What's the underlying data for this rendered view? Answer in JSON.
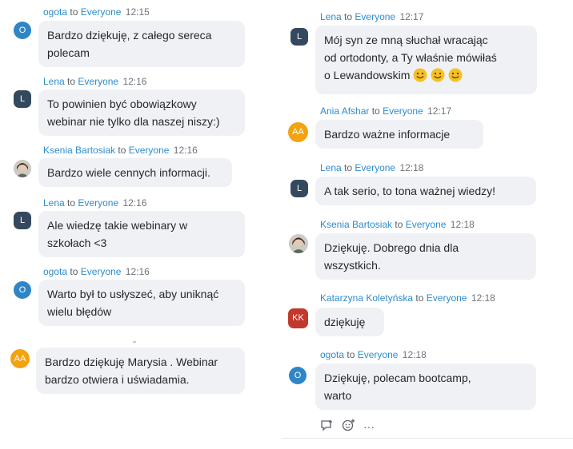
{
  "colors": {
    "name_blue": "#2d8ccf",
    "avatar_O": "#2f86c6",
    "avatar_L": "#34495e",
    "avatar_AA": "#f2a30f",
    "avatar_KK": "#c0392b",
    "bubble_bg": "#eff1f4"
  },
  "left": {
    "messages": [
      {
        "sender": "ogota",
        "to": "to",
        "target": "Everyone",
        "time": "12:15",
        "avatar": "O",
        "lines": [
          "Bardzo dziękuję, z całego sereca",
          "polecam"
        ]
      },
      {
        "sender": "Lena",
        "to": "to",
        "target": "Everyone",
        "time": "12:16",
        "avatar": "L",
        "lines": [
          "To powinien być obowiązkowy",
          "webinar nie tylko dla naszej niszy:)"
        ]
      },
      {
        "sender": "Ksenia Bartosiak",
        "to": "to",
        "target": "Everyone",
        "time": "12:16",
        "avatar": "photo",
        "lines": [
          "Bardzo wiele cennych informacji."
        ]
      },
      {
        "sender": "Lena",
        "to": "to",
        "target": "Everyone",
        "time": "12:16",
        "avatar": "L",
        "lines": [
          "Ale wiedzę takie webinary w",
          "szkołach <3"
        ]
      },
      {
        "sender": "ogota",
        "to": "to",
        "target": "Everyone",
        "time": "12:16",
        "avatar": "O",
        "lines": [
          "Warto był to usłyszeć, aby uniknąć",
          "wielu błędów"
        ]
      },
      {
        "avatar": "AA",
        "lines": [
          "Bardzo dziękuję Marysia . Webinar",
          "bardzo otwiera i uświadamia."
        ]
      }
    ]
  },
  "right": {
    "messages": [
      {
        "sender": "Lena",
        "to": "to",
        "target": "Everyone",
        "time": "12:17",
        "avatar": "L",
        "lines": [
          "Mój syn ze mną słuchał wracając",
          "od ortodonty, a Ty właśnie mówiłaś",
          "o Lewandowskim"
        ]
      },
      {
        "sender": "Ania Afshar",
        "to": "to",
        "target": "Everyone",
        "time": "12:17",
        "avatar": "AA",
        "lines": [
          "Bardzo ważne informacje"
        ]
      },
      {
        "sender": "Lena",
        "to": "to",
        "target": "Everyone",
        "time": "12:18",
        "avatar": "L",
        "lines": [
          "A tak serio, to tona ważnej wiedzy!"
        ]
      },
      {
        "sender": "Ksenia Bartosiak",
        "to": "to",
        "target": "Everyone",
        "time": "12:18",
        "avatar": "photo",
        "lines": [
          "Dziękuję. Dobrego dnia dla",
          "wszystkich."
        ]
      },
      {
        "sender": "Katarzyna Koletyńska",
        "to": "to",
        "target": "Everyone",
        "time": "12:18",
        "avatar": "KK",
        "lines": [
          "dziękuję"
        ]
      },
      {
        "sender": "ogota",
        "to": "to",
        "target": "Everyone",
        "time": "12:18",
        "avatar": "O",
        "lines": [
          "Dziękuję, polecam bootcamp,",
          "warto"
        ]
      }
    ],
    "actions": [
      "reply-icon",
      "add-reaction-icon",
      "more-icon"
    ],
    "more_label": "···"
  }
}
